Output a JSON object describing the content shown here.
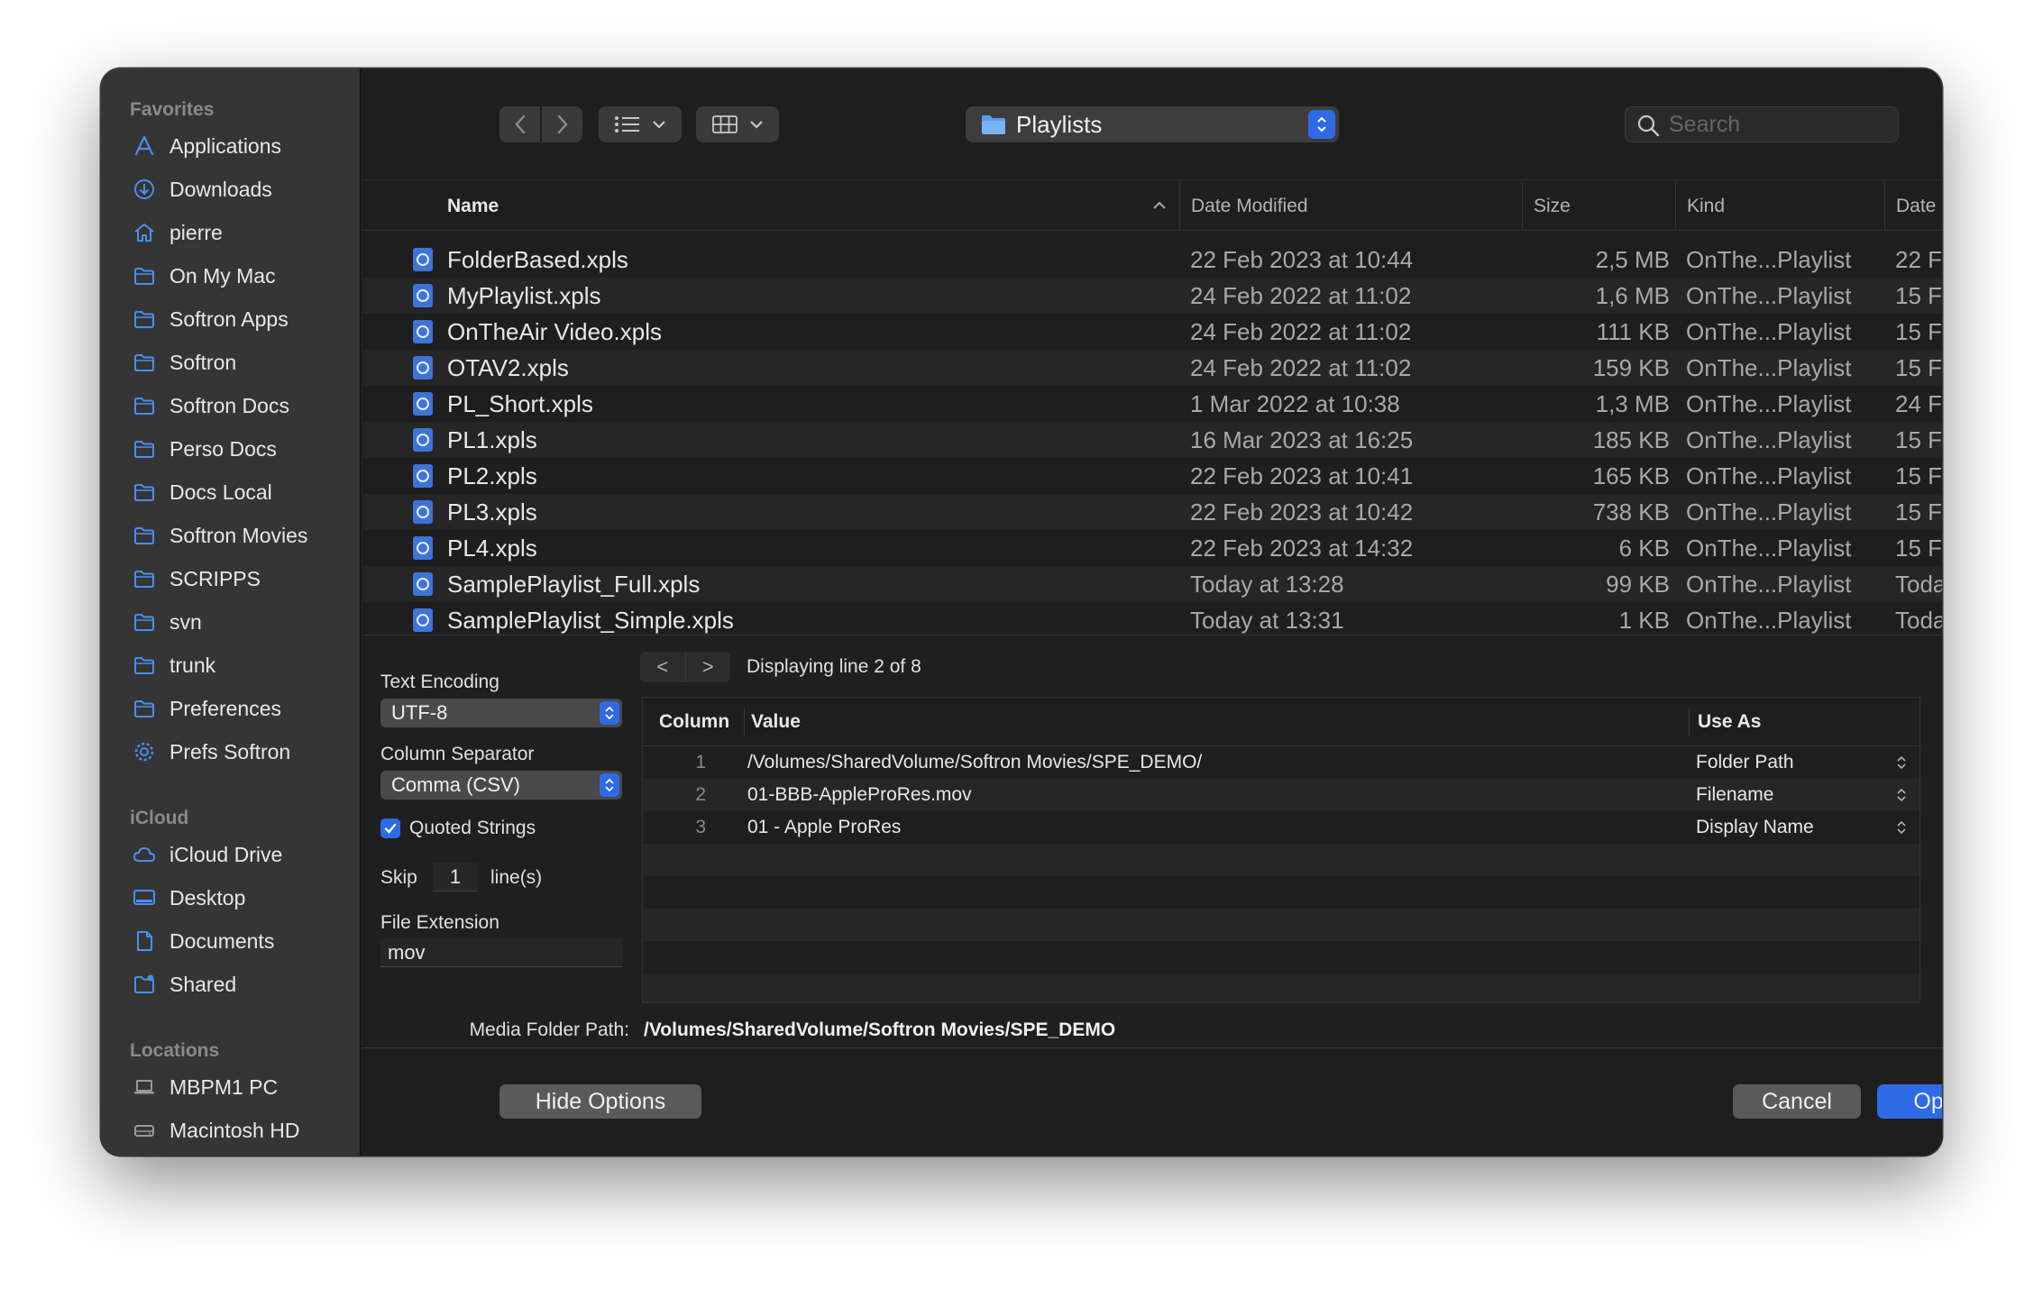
{
  "sidebar": {
    "favorites_title": "Favorites",
    "favorites": [
      {
        "label": "Applications",
        "icon": "applications-icon"
      },
      {
        "label": "Downloads",
        "icon": "downloads-icon"
      },
      {
        "label": "pierre",
        "icon": "home-icon"
      },
      {
        "label": "On My Mac",
        "icon": "folder-icon"
      },
      {
        "label": "Softron Apps",
        "icon": "folder-icon"
      },
      {
        "label": "Softron",
        "icon": "folder-icon"
      },
      {
        "label": "Softron Docs",
        "icon": "folder-icon"
      },
      {
        "label": "Perso Docs",
        "icon": "folder-icon"
      },
      {
        "label": "Docs Local",
        "icon": "folder-icon"
      },
      {
        "label": "Softron Movies",
        "icon": "folder-icon"
      },
      {
        "label": "SCRIPPS",
        "icon": "folder-icon"
      },
      {
        "label": "svn",
        "icon": "folder-icon"
      },
      {
        "label": "trunk",
        "icon": "folder-icon"
      },
      {
        "label": "Preferences",
        "icon": "folder-icon"
      },
      {
        "label": "Prefs Softron",
        "icon": "gear-icon"
      }
    ],
    "icloud_title": "iCloud",
    "icloud": [
      {
        "label": "iCloud Drive",
        "icon": "cloud-icon"
      },
      {
        "label": "Desktop",
        "icon": "desktop-icon"
      },
      {
        "label": "Documents",
        "icon": "document-icon"
      },
      {
        "label": "Shared",
        "icon": "shared-folder-icon"
      }
    ],
    "locations_title": "Locations",
    "locations": [
      {
        "label": "MBPM1 PC",
        "icon": "laptop-icon"
      },
      {
        "label": "Macintosh HD",
        "icon": "disk-icon"
      }
    ]
  },
  "toolbar": {
    "path": "Playlists",
    "search_placeholder": "Search"
  },
  "filelist": {
    "headers": {
      "name": "Name",
      "date_modified": "Date Modified",
      "size": "Size",
      "kind": "Kind",
      "date2": "Date"
    },
    "rows": [
      {
        "name": "FolderBased.xpls",
        "date": "22 Feb 2023 at 10:44",
        "size": "2,5 MB",
        "kind": "OnThe...Playlist",
        "date2": "22 F"
      },
      {
        "name": "MyPlaylist.xpls",
        "date": "24 Feb 2022 at 11:02",
        "size": "1,6 MB",
        "kind": "OnThe...Playlist",
        "date2": "15 F"
      },
      {
        "name": "OnTheAir Video.xpls",
        "date": "24 Feb 2022 at 11:02",
        "size": "111 KB",
        "kind": "OnThe...Playlist",
        "date2": "15 F"
      },
      {
        "name": "OTAV2.xpls",
        "date": "24 Feb 2022 at 11:02",
        "size": "159 KB",
        "kind": "OnThe...Playlist",
        "date2": "15 F"
      },
      {
        "name": "PL_Short.xpls",
        "date": "1 Mar 2022 at 10:38",
        "size": "1,3 MB",
        "kind": "OnThe...Playlist",
        "date2": "24 F"
      },
      {
        "name": "PL1.xpls",
        "date": "16 Mar 2023 at 16:25",
        "size": "185 KB",
        "kind": "OnThe...Playlist",
        "date2": "15 F"
      },
      {
        "name": "PL2.xpls",
        "date": "22 Feb 2023 at 10:41",
        "size": "165 KB",
        "kind": "OnThe...Playlist",
        "date2": "15 F"
      },
      {
        "name": "PL3.xpls",
        "date": "22 Feb 2023 at 10:42",
        "size": "738 KB",
        "kind": "OnThe...Playlist",
        "date2": "15 F"
      },
      {
        "name": "PL4.xpls",
        "date": "22 Feb 2023 at 14:32",
        "size": "6 KB",
        "kind": "OnThe...Playlist",
        "date2": "15 F"
      },
      {
        "name": "SamplePlaylist_Full.xpls",
        "date": "Today at 13:28",
        "size": "99 KB",
        "kind": "OnThe...Playlist",
        "date2": "Toda"
      },
      {
        "name": "SamplePlaylist_Simple.xpls",
        "date": "Today at 13:31",
        "size": "1 KB",
        "kind": "OnThe...Playlist",
        "date2": "Toda"
      }
    ]
  },
  "options": {
    "text_encoding_label": "Text Encoding",
    "text_encoding_value": "UTF-8",
    "column_separator_label": "Column Separator",
    "column_separator_value": "Comma (CSV)",
    "quoted_strings_label": "Quoted Strings",
    "quoted_strings_checked": true,
    "skip_label": "Skip",
    "skip_value": "1",
    "skip_suffix": "line(s)",
    "file_extension_label": "File Extension",
    "file_extension_value": "mov",
    "prev_label": "<",
    "next_label": ">",
    "line_info": "Displaying line 2 of 8",
    "table_headers": {
      "column": "Column",
      "value": "Value",
      "use_as": "Use As"
    },
    "table_rows": [
      {
        "n": "1",
        "value": "/Volumes/SharedVolume/Softron Movies/SPE_DEMO/",
        "use_as": "Folder Path"
      },
      {
        "n": "2",
        "value": "01-BBB-AppleProRes.mov",
        "use_as": "Filename"
      },
      {
        "n": "3",
        "value": "01 - Apple ProRes",
        "use_as": "Display Name"
      }
    ],
    "media_folder_label": "Media Folder Path:",
    "media_folder_value": "/Volumes/SharedVolume/Softron Movies/SPE_DEMO"
  },
  "buttons": {
    "hide_options": "Hide Options",
    "cancel": "Cancel",
    "open": "Open"
  },
  "colors": {
    "accent": "#2e6ae6",
    "sidebar_icon": "#4a8ef0"
  }
}
